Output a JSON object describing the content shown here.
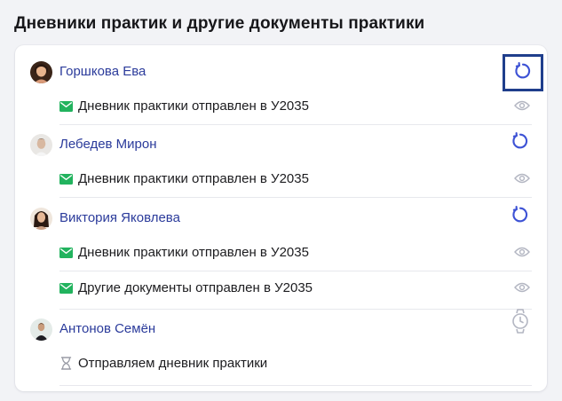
{
  "page": {
    "title": "Дневники практик и другие документы практики"
  },
  "colors": {
    "link": "#2b3b9b",
    "accent_blue": "#3d52d5",
    "sent_green": "#22b35e",
    "muted_icon": "#b3b6c2"
  },
  "students": [
    {
      "name": "Горшкова Ева",
      "action_icon": "refresh-icon",
      "focused": true,
      "documents": [
        {
          "status_icon": "envelope-icon",
          "text": "Дневник практики отправлен в У2035",
          "view_icon": "eye-icon"
        }
      ]
    },
    {
      "name": "Лебедев Мирон",
      "action_icon": "refresh-icon",
      "focused": false,
      "documents": [
        {
          "status_icon": "envelope-icon",
          "text": "Дневник практики отправлен в У2035",
          "view_icon": "eye-icon"
        }
      ]
    },
    {
      "name": "Виктория Яковлева",
      "action_icon": "refresh-icon",
      "focused": false,
      "documents": [
        {
          "status_icon": "envelope-icon",
          "text": "Дневник практики отправлен в У2035",
          "view_icon": "eye-icon"
        },
        {
          "status_icon": "envelope-icon",
          "text": "Другие документы отправлен в У2035",
          "view_icon": "eye-icon"
        }
      ]
    },
    {
      "name": "Антонов Семён",
      "action_icon": "watch-icon",
      "focused": false,
      "documents": [
        {
          "status_icon": "hourglass-icon",
          "text": "Отправляем дневник практики",
          "view_icon": ""
        }
      ]
    }
  ]
}
